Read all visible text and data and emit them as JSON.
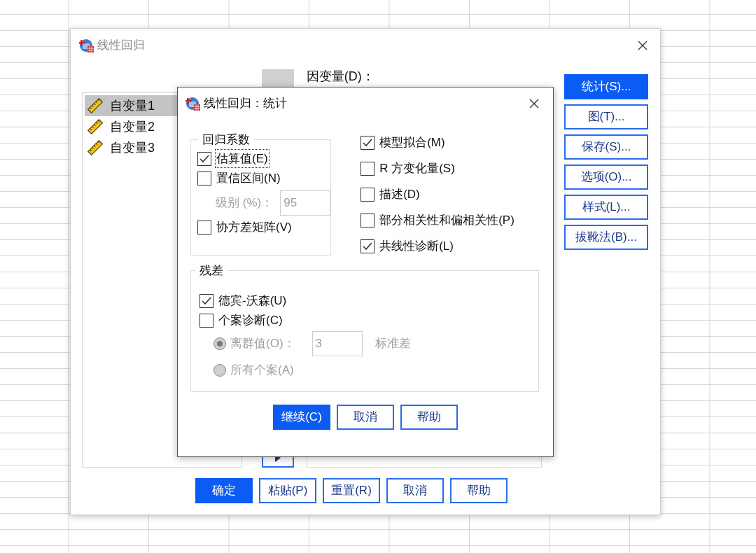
{
  "main_window": {
    "title": "线性回归",
    "variables": [
      {
        "name": "自变量1",
        "selected": true
      },
      {
        "name": "自变量2",
        "selected": false
      },
      {
        "name": "自变量3",
        "selected": false
      }
    ],
    "dependent_label": "因变量(D)：",
    "side_buttons": [
      {
        "label": "统计(S)...",
        "selected": true
      },
      {
        "label": "图(T)...",
        "selected": false
      },
      {
        "label": "保存(S)...",
        "selected": false
      },
      {
        "label": "选项(O)...",
        "selected": false
      },
      {
        "label": "样式(L)...",
        "selected": false
      },
      {
        "label": "拔靴法(B)...",
        "selected": false
      }
    ],
    "buttons": [
      {
        "label": "确定",
        "primary": true
      },
      {
        "label": "粘贴(P)",
        "primary": false
      },
      {
        "label": "重置(R)",
        "primary": false
      },
      {
        "label": "取消",
        "primary": false
      },
      {
        "label": "帮助",
        "primary": false
      }
    ]
  },
  "dialog": {
    "title": "线性回归：统计",
    "coefficients": {
      "title": "回归系数",
      "options": [
        {
          "kind": "checkbox",
          "label": "估算值(E)",
          "checked": true,
          "focused": true
        },
        {
          "kind": "checkbox",
          "label": "置信区间(N)",
          "checked": false,
          "focused": false
        },
        {
          "kind": "field",
          "label": "级别 (%)：",
          "value": "95",
          "disabled": true
        },
        {
          "kind": "checkbox",
          "label": "协方差矩阵(V)",
          "checked": false,
          "focused": false
        }
      ]
    },
    "options": [
      {
        "label": "模型拟合(M)",
        "checked": true
      },
      {
        "label": "R 方变化量(S)",
        "checked": false
      },
      {
        "label": "描述(D)",
        "checked": false
      },
      {
        "label": "部分相关性和偏相关性(P)",
        "checked": false
      },
      {
        "label": "共线性诊断(L)",
        "checked": true
      }
    ],
    "residuals": {
      "title": "残差",
      "options": [
        {
          "kind": "checkbox",
          "label": "德宾-沃森(U)",
          "checked": true,
          "focused": false
        },
        {
          "kind": "checkbox",
          "label": "个案诊断(C)",
          "checked": false,
          "focused": false
        },
        {
          "kind": "radio",
          "label": "离群值(O)：",
          "selected": true,
          "disabled": true,
          "value": "3",
          "unit": "标准差"
        },
        {
          "kind": "radio",
          "label": "所有个案(A)",
          "selected": false,
          "disabled": true
        }
      ]
    },
    "buttons": [
      {
        "label": "继续(C)",
        "primary": true
      },
      {
        "label": "取消",
        "primary": false
      },
      {
        "label": "帮助",
        "primary": false
      }
    ]
  }
}
